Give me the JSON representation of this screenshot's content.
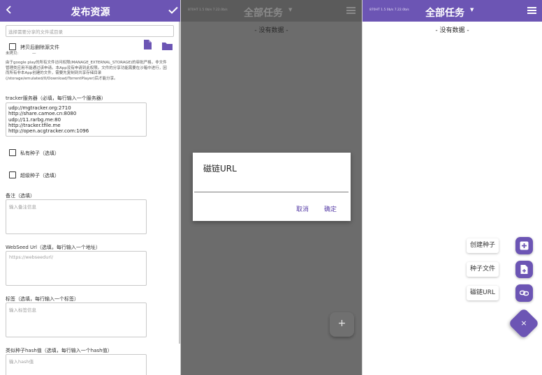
{
  "publish": {
    "title": "发布资源",
    "back_icon": "back-arrow-icon",
    "confirm_icon": "check-icon",
    "file_select_placeholder": "选择需要分享的文件或目录",
    "copy_delete_label": "拷贝后删除源文件",
    "not_copied_label": "未拷贝:",
    "not_copied_value": "—",
    "notice": "由于google play的所有文件访问权限(MANAGE_EXTERNAL_STORAGE)的审批严格，非文件管理类应用不能通过该申请。本App没有申请到此权限。文件的分享功能需要在沙箱中进行，因而所有非本App创建的文件，需要先复制到共享存储目录(/storage/emulated/0/Download/TorrentPlayer)后才能分享。",
    "tracker_label": "tracker服务器（必填，每行输入一个服务器）",
    "trackers": [
      "udp://mgtracker.org:2710",
      "http://share.camoe.cn:8080",
      "udp://11.rarbg.me:80",
      "http://tracker.tfile.me",
      "http://open.acgtracker.com:1096"
    ],
    "private_label": "私有种子（选填）",
    "super_label": "超级种子（选填）",
    "remark_label": "备注（选填）",
    "remark_placeholder": "输入备注信息",
    "webseed_label": "WebSeed Url（选填，每行输入一个地址）",
    "webseed_placeholder": "https://webseedurl/",
    "tags_label": "标签（选填，每行输入一个标签）",
    "tags_placeholder": "输入标签信息",
    "hash_label": "类似种子hash值（选填，每行输入一个hash值）",
    "hash_placeholder": "输入hash值",
    "file_icon": "file-icon",
    "folder_icon": "folder-icon"
  },
  "tasks_dialog": {
    "status_text": "870HT 1.5 0b/s 7.22.0b/s",
    "title": "全部任务",
    "empty_text": "- 没有数据 -",
    "dialog_title": "磁链URL",
    "cancel": "取消",
    "ok": "确定",
    "fab_symbol": "+"
  },
  "tasks_menu": {
    "status_text": "870HT 1.5 0b/s 7.22.0b/s",
    "title": "全部任务",
    "empty_text": "- 没有数据 -",
    "actions": [
      {
        "label": "创建种子",
        "icon": "add-box-icon"
      },
      {
        "label": "种子文件",
        "icon": "file-add-icon"
      },
      {
        "label": "磁链URL",
        "icon": "link-icon"
      }
    ],
    "close_symbol": "×"
  },
  "colors": {
    "primary": "#6c55b4",
    "scrim_bar": "#5b5b5b",
    "scrim": "#6c6c6c"
  }
}
